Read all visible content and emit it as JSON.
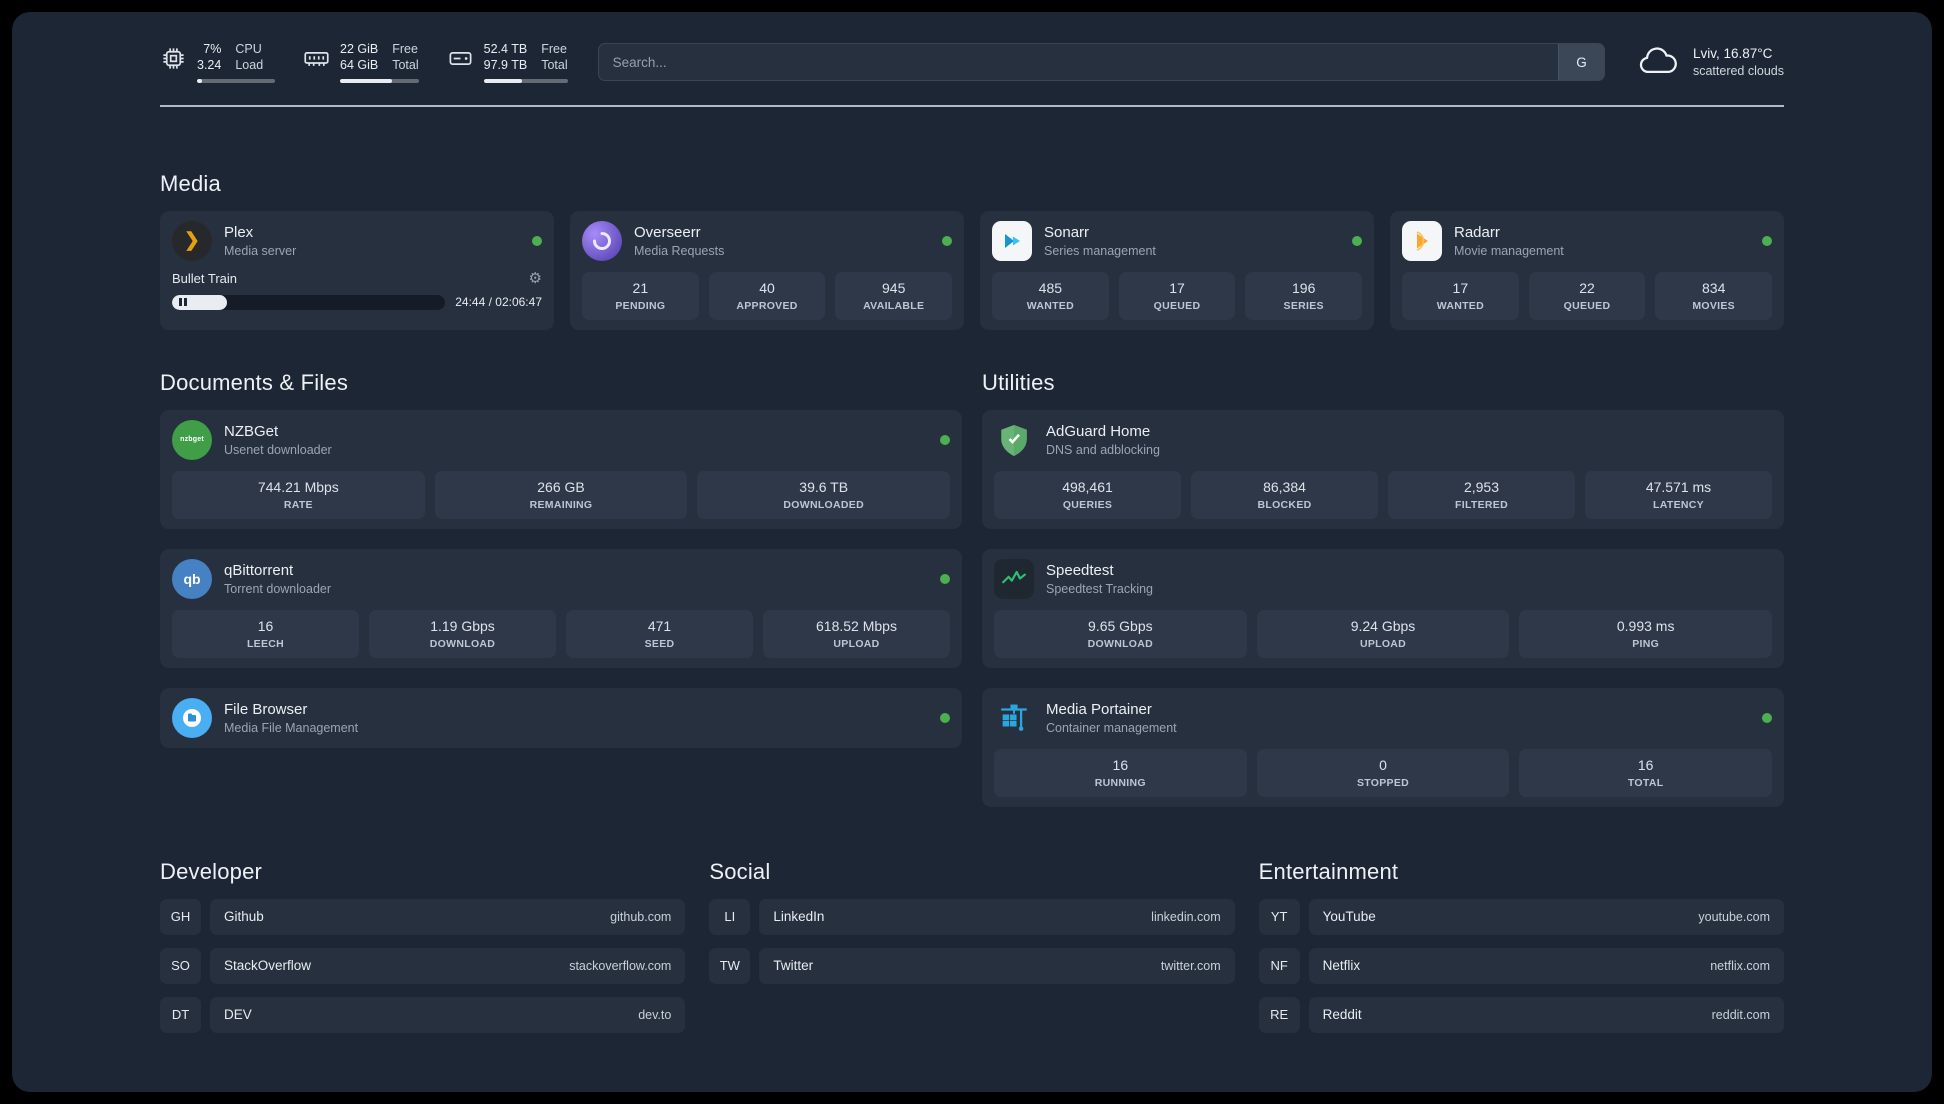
{
  "topbar": {
    "resources": [
      {
        "name": "cpu",
        "values": [
          "7%",
          "3.24"
        ],
        "labels": [
          "CPU",
          "Load"
        ],
        "fill": 7
      },
      {
        "name": "memory",
        "values": [
          "22 GiB",
          "64 GiB"
        ],
        "labels": [
          "Free",
          "Total"
        ],
        "fill": 66
      },
      {
        "name": "disk",
        "values": [
          "52.4 TB",
          "97.9 TB"
        ],
        "labels": [
          "Free",
          "Total"
        ],
        "fill": 46
      }
    ],
    "search": {
      "placeholder": "Search...",
      "button_label": "G"
    },
    "weather": {
      "location": "Lviv, 16.87°C",
      "condition": "scattered clouds"
    }
  },
  "media": {
    "title": "Media",
    "plex": {
      "name": "Plex",
      "subtitle": "Media server",
      "player": {
        "track": "Bullet Train",
        "time": "24:44 / 02:06:47",
        "progress": 20
      }
    },
    "overseerr": {
      "name": "Overseerr",
      "subtitle": "Media Requests",
      "stats": [
        {
          "value": "21",
          "label": "PENDING"
        },
        {
          "value": "40",
          "label": "APPROVED"
        },
        {
          "value": "945",
          "label": "AVAILABLE"
        }
      ]
    },
    "sonarr": {
      "name": "Sonarr",
      "subtitle": "Series management",
      "stats": [
        {
          "value": "485",
          "label": "WANTED"
        },
        {
          "value": "17",
          "label": "QUEUED"
        },
        {
          "value": "196",
          "label": "SERIES"
        }
      ]
    },
    "radarr": {
      "name": "Radarr",
      "subtitle": "Movie management",
      "stats": [
        {
          "value": "17",
          "label": "WANTED"
        },
        {
          "value": "22",
          "label": "QUEUED"
        },
        {
          "value": "834",
          "label": "MOVIES"
        }
      ]
    }
  },
  "files": {
    "title": "Documents & Files",
    "nzbget": {
      "name": "NZBGet",
      "subtitle": "Usenet downloader",
      "stats": [
        {
          "value": "744.21 Mbps",
          "label": "RATE"
        },
        {
          "value": "266 GB",
          "label": "REMAINING"
        },
        {
          "value": "39.6 TB",
          "label": "DOWNLOADED"
        }
      ]
    },
    "qbittorrent": {
      "name": "qBittorrent",
      "subtitle": "Torrent downloader",
      "stats": [
        {
          "value": "16",
          "label": "LEECH"
        },
        {
          "value": "1.19 Gbps",
          "label": "DOWNLOAD"
        },
        {
          "value": "471",
          "label": "SEED"
        },
        {
          "value": "618.52 Mbps",
          "label": "UPLOAD"
        }
      ]
    },
    "filebrowser": {
      "name": "File Browser",
      "subtitle": "Media File Management"
    }
  },
  "utilities": {
    "title": "Utilities",
    "adguard": {
      "name": "AdGuard Home",
      "subtitle": "DNS and adblocking",
      "stats": [
        {
          "value": "498,461",
          "label": "QUERIES"
        },
        {
          "value": "86,384",
          "label": "BLOCKED"
        },
        {
          "value": "2,953",
          "label": "FILTERED"
        },
        {
          "value": "47.571 ms",
          "label": "LATENCY"
        }
      ]
    },
    "speedtest": {
      "name": "Speedtest",
      "subtitle": "Speedtest Tracking",
      "stats": [
        {
          "value": "9.65 Gbps",
          "label": "DOWNLOAD"
        },
        {
          "value": "9.24 Gbps",
          "label": "UPLOAD"
        },
        {
          "value": "0.993 ms",
          "label": "PING"
        }
      ]
    },
    "portainer": {
      "name": "Media Portainer",
      "subtitle": "Container management",
      "stats": [
        {
          "value": "16",
          "label": "RUNNING"
        },
        {
          "value": "0",
          "label": "STOPPED"
        },
        {
          "value": "16",
          "label": "TOTAL"
        }
      ]
    }
  },
  "bookmarks": [
    {
      "title": "Developer",
      "items": [
        {
          "abbr": "GH",
          "name": "Github",
          "url": "github.com"
        },
        {
          "abbr": "SO",
          "name": "StackOverflow",
          "url": "stackoverflow.com"
        },
        {
          "abbr": "DT",
          "name": "DEV",
          "url": "dev.to"
        }
      ]
    },
    {
      "title": "Social",
      "items": [
        {
          "abbr": "LI",
          "name": "LinkedIn",
          "url": "linkedin.com"
        },
        {
          "abbr": "TW",
          "name": "Twitter",
          "url": "twitter.com"
        }
      ]
    },
    {
      "title": "Entertainment",
      "items": [
        {
          "abbr": "YT",
          "name": "YouTube",
          "url": "youtube.com"
        },
        {
          "abbr": "NF",
          "name": "Netflix",
          "url": "netflix.com"
        },
        {
          "abbr": "RE",
          "name": "Reddit",
          "url": "reddit.com"
        }
      ]
    }
  ],
  "icons": {
    "nzbget_text": "nzbget",
    "qbittorrent_text": "qb"
  },
  "colors": {
    "status_online": "#4caf50"
  }
}
